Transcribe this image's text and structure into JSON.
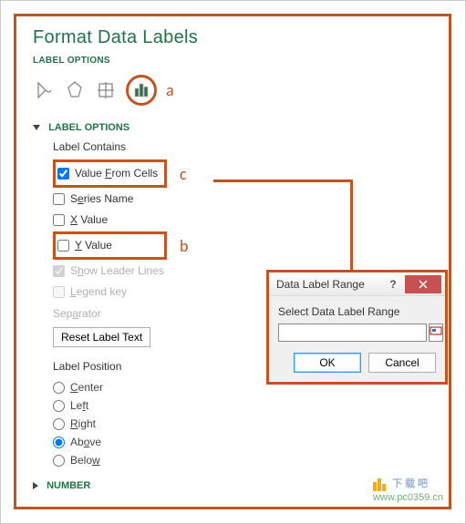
{
  "pane": {
    "title": "Format Data Labels",
    "subtitle": "LABEL OPTIONS",
    "icons": {
      "fill": "fill-line-icon",
      "effects": "effects-icon",
      "size": "size-properties-icon",
      "options": "label-options-icon"
    },
    "annotations": {
      "a": "a",
      "b": "b",
      "c": "c"
    },
    "sections": {
      "label_options": {
        "header": "LABEL OPTIONS",
        "label_contains": "Label Contains",
        "value_from_cells": "Value From Cells",
        "series_name": "Series Name",
        "x_value": "X Value",
        "y_value": "Y Value",
        "show_leader": "Show Leader Lines",
        "legend_key": "Legend key",
        "separator": "Separator",
        "reset": "Reset Label Text",
        "label_position": "Label Position",
        "pos": {
          "center": "Center",
          "left": "Left",
          "right": "Right",
          "above": "Above",
          "below": "Below"
        }
      },
      "number": {
        "header": "NUMBER"
      }
    }
  },
  "dialog": {
    "title": "Data Label Range",
    "label": "Select Data Label Range",
    "value": "",
    "ok": "OK",
    "cancel": "Cancel"
  },
  "watermark": {
    "brand": "下载吧",
    "url": "www.pc0359.cn"
  }
}
